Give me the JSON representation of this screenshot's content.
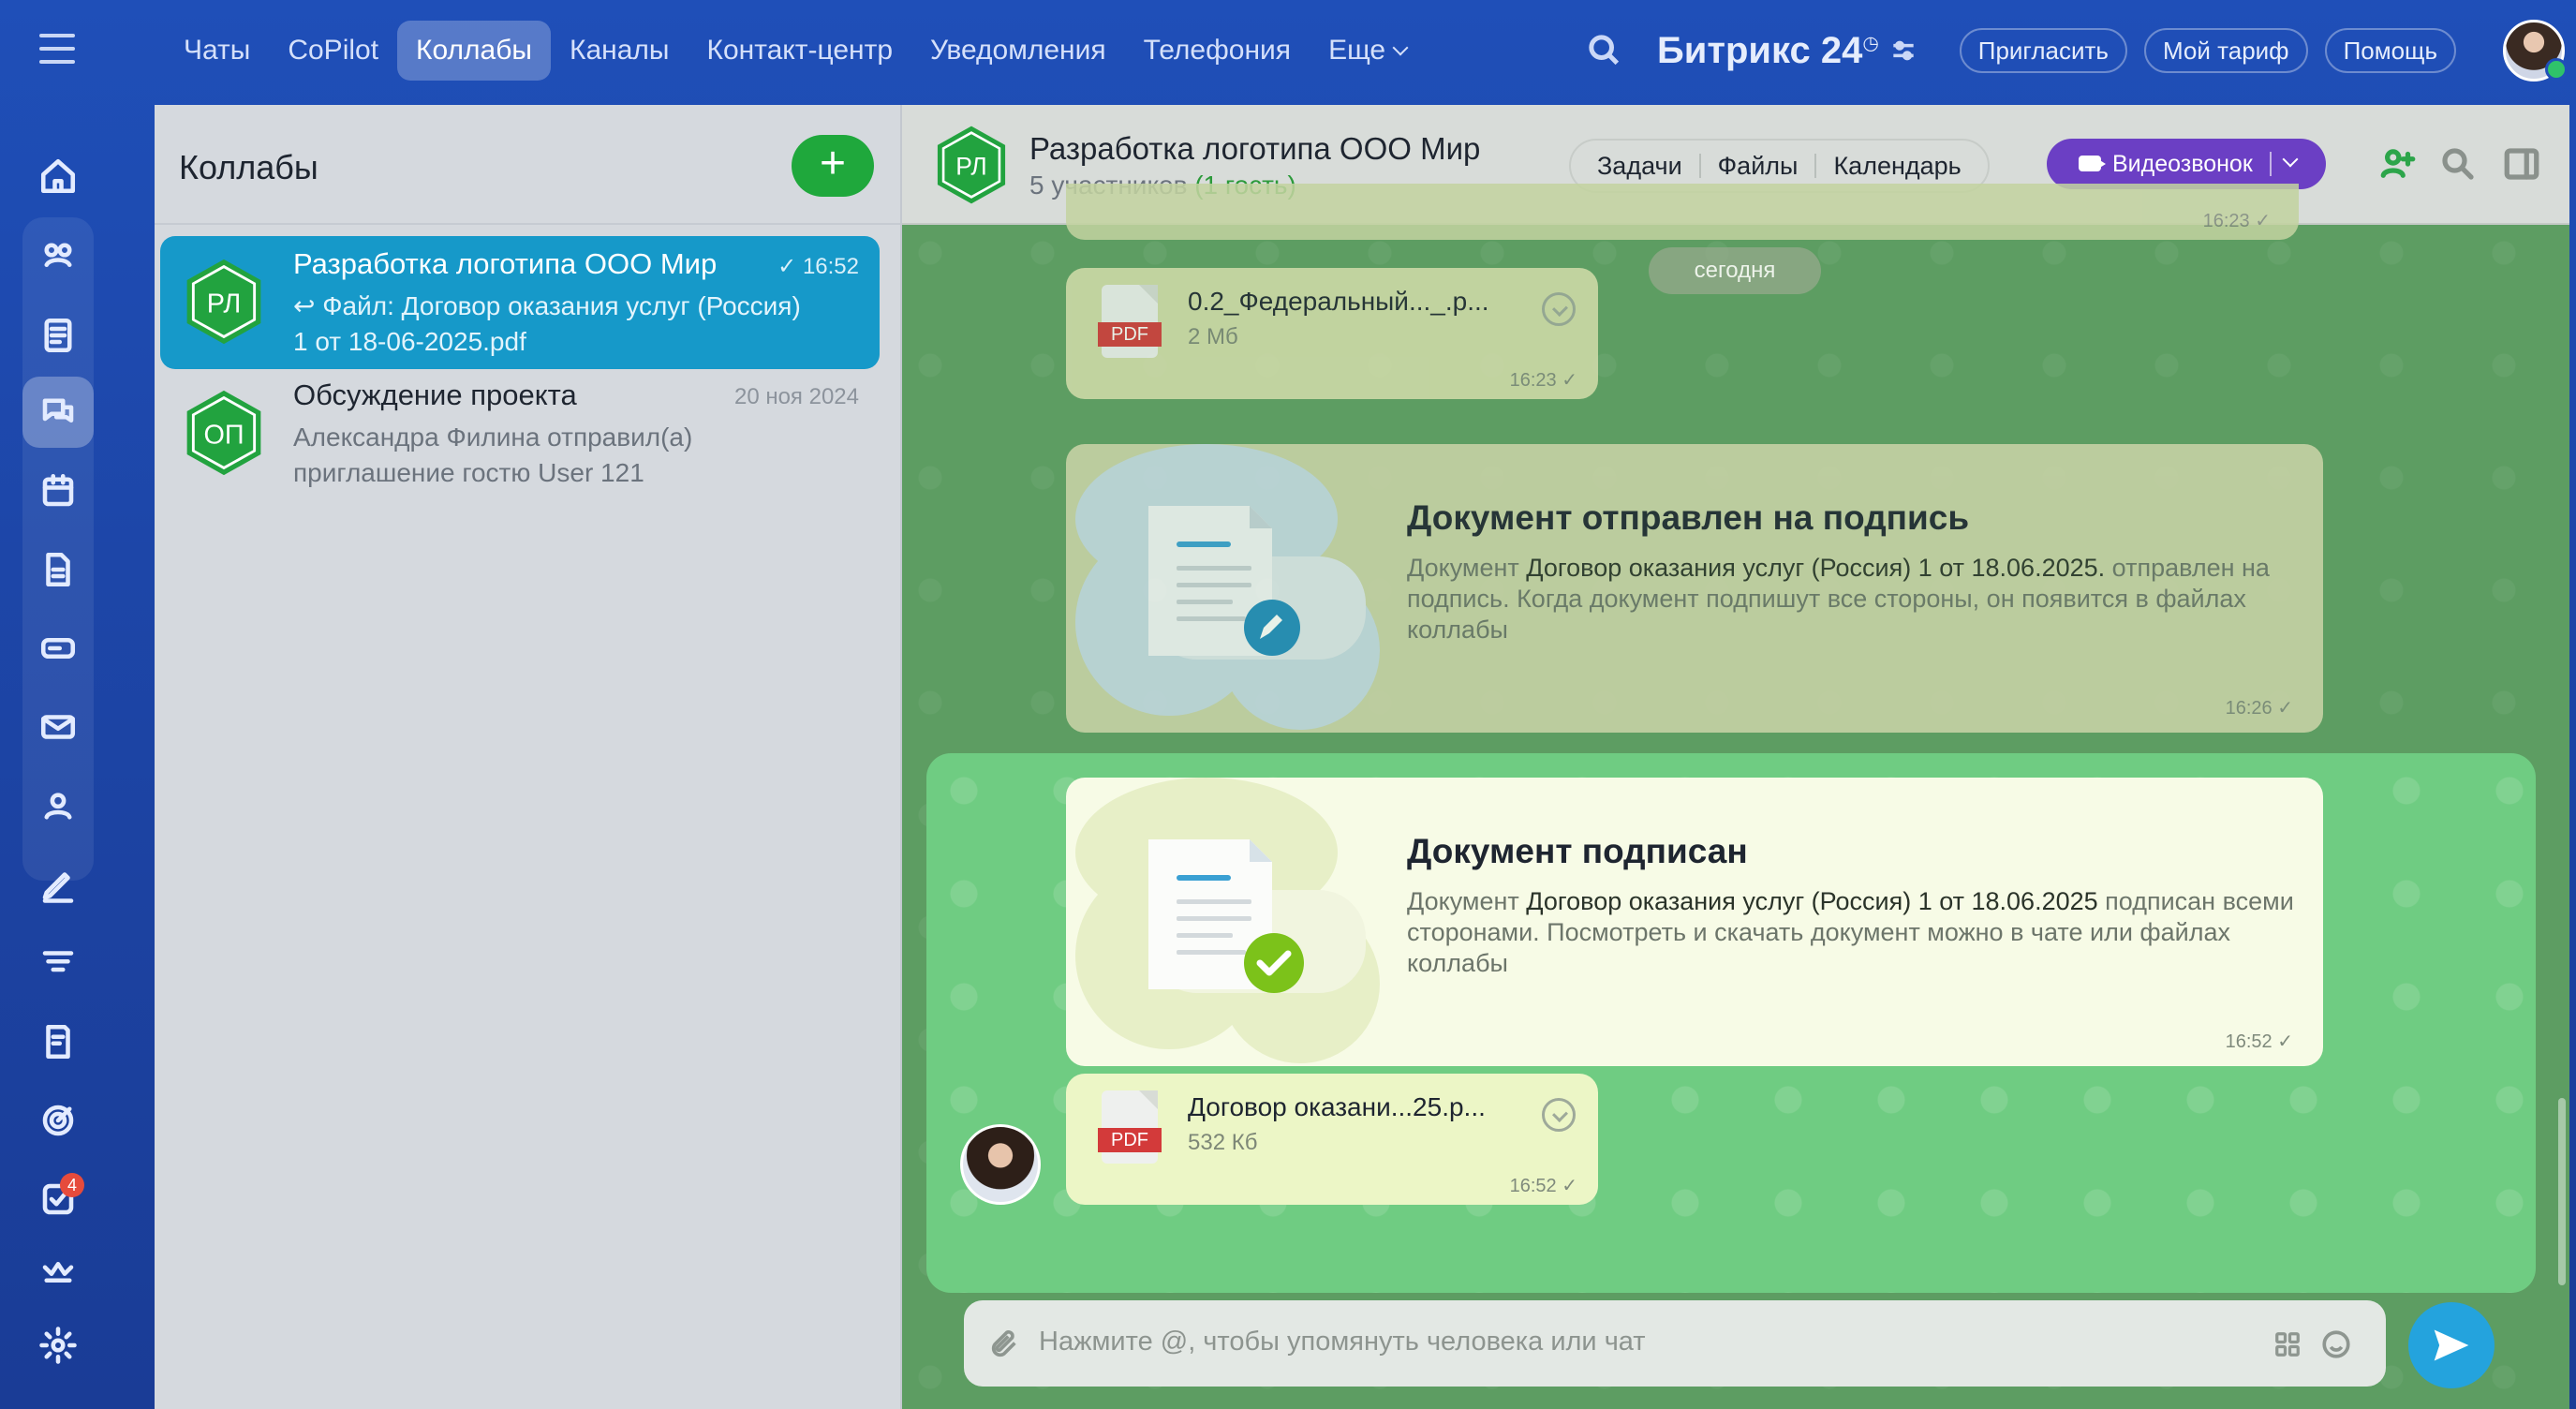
{
  "nav": {
    "tabs": [
      {
        "label": "Чаты",
        "active": false
      },
      {
        "label": "CoPilot",
        "active": false
      },
      {
        "label": "Коллабы",
        "active": true
      },
      {
        "label": "Каналы",
        "active": false
      },
      {
        "label": "Контакт-центр",
        "active": false
      },
      {
        "label": "Уведомления",
        "active": false
      },
      {
        "label": "Телефония",
        "active": false
      },
      {
        "label": "Еще",
        "active": false
      }
    ],
    "brand": "Битрикс 24",
    "invite": "Пригласить",
    "tariff": "Мой тариф",
    "help": "Помощь"
  },
  "rail": {
    "tasks_badge": "4",
    "icons": [
      "home-icon",
      "feed-icon",
      "list-icon",
      "chats-icon",
      "calendar-icon",
      "docs-icon",
      "drive-icon",
      "mail-icon",
      "contacts-icon",
      "sign-icon",
      "filter-icon",
      "forms-icon",
      "target-icon",
      "tasks-icon",
      "crown-icon",
      "settings-icon"
    ]
  },
  "collabs": {
    "title": "Коллабы",
    "add_label": "+",
    "items": [
      {
        "initials": "РЛ",
        "name": "Разработка логотипа ООО Мир",
        "time": "16:52",
        "preview": "Файл: Договор оказания услуг (Россия) 1 от 18-06-2025.pdf",
        "selected": true
      },
      {
        "initials": "ОП",
        "name": "Обсуждение проекта",
        "time": "20 ноя 2024",
        "preview": "Александра Филина отправил(а) приглашение гостю User 121",
        "selected": false
      }
    ]
  },
  "dialog": {
    "initials": "РЛ",
    "title": "Разработка логотипа ООО Мир",
    "members": "5 участников",
    "guests": "(1 гость)",
    "tasks": "Задачи",
    "files": "Файлы",
    "calendar": "Календарь",
    "video": "Видеозвонок",
    "partial_time": "16:23",
    "today": "сегодня",
    "file1": {
      "name": "0.2_Федеральный..._.p...",
      "size": "2 Мб",
      "time": "16:23",
      "type": "PDF"
    },
    "sys1": {
      "title": "Документ отправлен на подпись",
      "pre": "Документ ",
      "doc": "Договор оказания услуг (Россия) 1 от 18.06.2025.",
      "post": " отправлен на подпись. Когда документ подпишут все стороны, он появится в файлах коллабы",
      "time": "16:26"
    },
    "sys2": {
      "title": "Документ подписан",
      "pre": "Документ ",
      "doc": "Договор оказания услуг (Россия) 1 от 18.06.2025",
      "post": " подписан всеми сторонами. Посмотреть и скачать документ можно в чате или файлах коллабы",
      "time": "16:52"
    },
    "file2": {
      "name": "Договор оказани...25.p...",
      "size": "532 Кб",
      "time": "16:52",
      "type": "PDF"
    },
    "input_placeholder": "Нажмите @, чтобы упомянуть человека или чат"
  },
  "colors": {
    "accent": "#1fa83c",
    "selected": "#1699c9",
    "video": "#6b3fc4",
    "send": "#24a3dd"
  }
}
